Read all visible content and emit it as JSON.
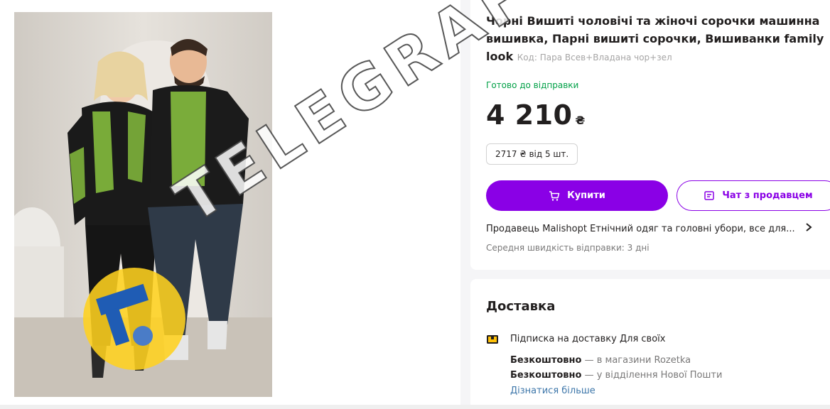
{
  "product": {
    "title": "Чорні Вишиті чоловічі та жіночі сорочки машинна вишивка, Парні вишиті сорочки, Вишиванки family look",
    "code": "Код: Пара Всев+Владана чор+зел",
    "status": "Готово до відправки",
    "price": "4 210",
    "currency": "₴",
    "wholesale": "2717 ₴ від 5 шт.",
    "buy_label": "Купити",
    "chat_label": "Чат з продавцем",
    "seller_text": "Продавець Malishopt Етнічний одяг та головні убори, все для...",
    "shipping_speed": "Середня швидкість відправки: 3 дні"
  },
  "delivery": {
    "title": "Доставка",
    "subscription": "Підписка на доставку Для своїх",
    "option1_bold": "Безкоштовно",
    "option1_rest": " — в магазини Rozetka",
    "option2_bold": "Безкоштовно",
    "option2_rest": " — у відділення Нової Пошти",
    "more_link": "Дізнатися більше"
  },
  "watermark": {
    "text": "TELEGRAF"
  },
  "colors": {
    "accent": "#8a00e6",
    "ready_green": "#00a046",
    "link_blue": "#3e77aa",
    "embroidery_green": "#8bc53f"
  },
  "icons": {
    "cart": "cart-icon",
    "chat": "chat-icon",
    "chevron": "chevron-right-icon",
    "delivery": "delivery-box-icon"
  }
}
